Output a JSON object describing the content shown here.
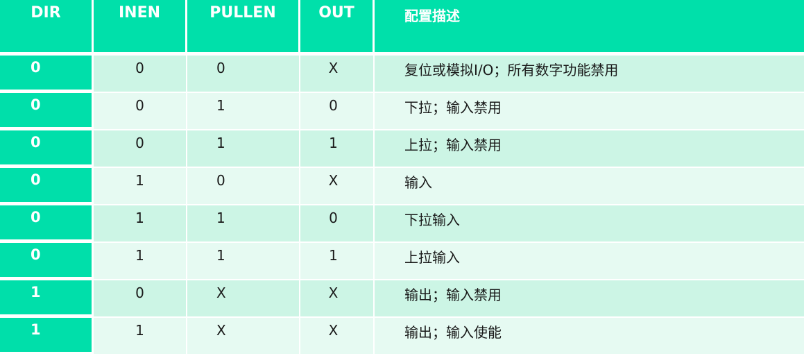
{
  "headers": {
    "dir": "DIR",
    "inen": "INEN",
    "pullen": "PULLEN",
    "out": "OUT",
    "desc": "配置描述"
  },
  "rows": [
    {
      "dir": "0",
      "inen": "0",
      "pullen": "0",
      "out": "X",
      "desc": "复位或模拟I/O；所有数字功能禁用"
    },
    {
      "dir": "0",
      "inen": "0",
      "pullen": "1",
      "out": "0",
      "desc": "下拉；输入禁用"
    },
    {
      "dir": "0",
      "inen": "0",
      "pullen": "1",
      "out": "1",
      "desc": "上拉；输入禁用"
    },
    {
      "dir": "0",
      "inen": "1",
      "pullen": "0",
      "out": "X",
      "desc": "输入"
    },
    {
      "dir": "0",
      "inen": "1",
      "pullen": "1",
      "out": "0",
      "desc": "下拉输入"
    },
    {
      "dir": "0",
      "inen": "1",
      "pullen": "1",
      "out": "1",
      "desc": "上拉输入"
    },
    {
      "dir": "1",
      "inen": "0",
      "pullen": "X",
      "out": "X",
      "desc": "输出；输入禁用"
    },
    {
      "dir": "1",
      "inen": "1",
      "pullen": "X",
      "out": "X",
      "desc": "输出；输入使能"
    }
  ],
  "colors": {
    "header_bg": "#00e0aa",
    "row_odd_bg": "#ccf5e5",
    "row_even_bg": "#e6faf2"
  }
}
